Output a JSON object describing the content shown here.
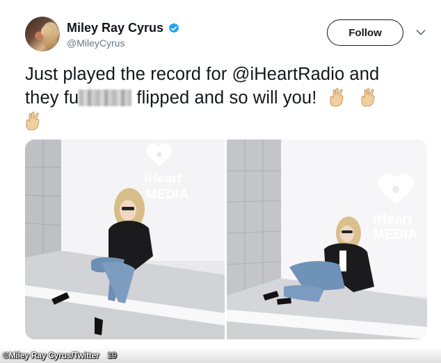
{
  "tweet": {
    "display_name": "Miley Ray Cyrus",
    "handle": "@MileyCyrus",
    "follow_label": "Follow",
    "verified": true,
    "text_line1": "Just played the record for @iHeartRadio and",
    "text_line2_start": "they fu",
    "text_line2_end": " flipped and so will you!",
    "emoji": "crossed-fingers"
  },
  "photos": {
    "left": {
      "logo_line1": "iHeart",
      "logo_line2": "MEDIA"
    },
    "right": {
      "logo_line1": "iHeart",
      "logo_line2": "MEDIA"
    }
  },
  "footer": {
    "date_fragment": "19"
  },
  "credit": "©Miley Ray Cyrus/Twitter",
  "colors": {
    "verified_blue": "#1da1f2",
    "text": "#14171a",
    "handle_gray": "#657786"
  }
}
